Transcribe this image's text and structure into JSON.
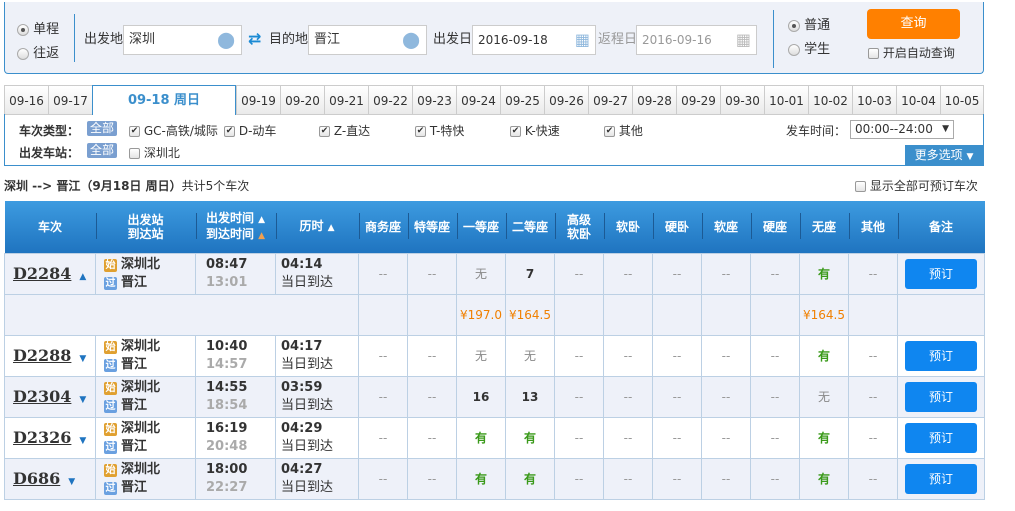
{
  "search": {
    "trip_types": [
      "单程",
      "往返"
    ],
    "trip_selected": 0,
    "from_label": "出发地",
    "from_value": "深圳",
    "to_label": "目的地",
    "to_value": "晋江",
    "depart_label": "出发日",
    "depart_value": "2016-09-18",
    "return_label": "返程日",
    "return_value": "2016-09-16",
    "passenger_types": [
      "普通",
      "学生"
    ],
    "passenger_selected": 0,
    "query_label": "查询",
    "auto_query_label": "开启自动查询",
    "accent": "#ff8000"
  },
  "dates": {
    "items": [
      "09-16",
      "09-17",
      "09-18 周日",
      "09-19",
      "09-20",
      "09-21",
      "09-22",
      "09-23",
      "09-24",
      "09-25",
      "09-26",
      "09-27",
      "09-28",
      "09-29",
      "09-30",
      "10-01",
      "10-02",
      "10-03",
      "10-04",
      "10-05"
    ],
    "selected": 2
  },
  "filter": {
    "type_label": "车次类型：",
    "all_label": "全部",
    "types": [
      "GC-高铁/城际",
      "D-动车",
      "Z-直达",
      "T-特快",
      "K-快速",
      "其他"
    ],
    "station_label": "出发车站：",
    "stations": [
      "深圳北"
    ],
    "time_label": "发车时间：",
    "time_value": "00:00--24:00",
    "more_label": "更多选项"
  },
  "summary": {
    "route": "深圳 --> 晋江（9月18日  周日）",
    "count": "共计5个车次",
    "show_all_label": "显示全部可预订车次"
  },
  "table": {
    "headers": [
      "车次",
      "出发站\n到达站",
      "出发时间\n到达时间",
      "历时",
      "商务座",
      "特等座",
      "一等座",
      "二等座",
      "高级\n软卧",
      "软卧",
      "硬卧",
      "软座",
      "硬座",
      "无座",
      "其他",
      "备注"
    ],
    "start_tag": "始",
    "pass_tag": "过",
    "book_label": "预订",
    "rows": [
      {
        "train": "D2284",
        "from": "深圳北",
        "to": "晋江",
        "dep": "08:47",
        "arr": "13:01",
        "dur": "04:14",
        "arrive_note": "当日到达",
        "seats": [
          "--",
          "--",
          "无",
          "7",
          "--",
          "--",
          "--",
          "--",
          "--",
          "有",
          "--"
        ],
        "expanded": true,
        "prices": [
          "",
          "",
          "¥197.0",
          "¥164.5",
          "",
          "",
          "",
          "",
          "",
          "¥164.5",
          ""
        ]
      },
      {
        "train": "D2288",
        "from": "深圳北",
        "to": "晋江",
        "dep": "10:40",
        "arr": "14:57",
        "dur": "04:17",
        "arrive_note": "当日到达",
        "seats": [
          "--",
          "--",
          "无",
          "无",
          "--",
          "--",
          "--",
          "--",
          "--",
          "有",
          "--"
        ]
      },
      {
        "train": "D2304",
        "from": "深圳北",
        "to": "晋江",
        "dep": "14:55",
        "arr": "18:54",
        "dur": "03:59",
        "arrive_note": "当日到达",
        "seats": [
          "--",
          "--",
          "16",
          "13",
          "--",
          "--",
          "--",
          "--",
          "--",
          "无",
          "--"
        ]
      },
      {
        "train": "D2326",
        "from": "深圳北",
        "to": "晋江",
        "dep": "16:19",
        "arr": "20:48",
        "dur": "04:29",
        "arrive_note": "当日到达",
        "seats": [
          "--",
          "--",
          "有",
          "有",
          "--",
          "--",
          "--",
          "--",
          "--",
          "有",
          "--"
        ]
      },
      {
        "train": "D686",
        "from": "深圳北",
        "to": "晋江",
        "dep": "18:00",
        "arr": "22:27",
        "dur": "04:27",
        "arrive_note": "当日到达",
        "seats": [
          "--",
          "--",
          "有",
          "有",
          "--",
          "--",
          "--",
          "--",
          "--",
          "有",
          "--"
        ]
      }
    ]
  }
}
